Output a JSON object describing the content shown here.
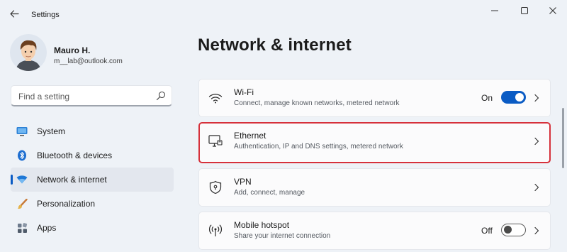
{
  "window": {
    "title": "Settings",
    "controls": [
      "minimize",
      "maximize",
      "close"
    ]
  },
  "profile": {
    "name": "Mauro H.",
    "email": "m__lab@outlook.com"
  },
  "search": {
    "placeholder": "Find a setting",
    "value": ""
  },
  "sidebar": {
    "items": [
      {
        "label": "System",
        "icon": "monitor-icon",
        "active": false
      },
      {
        "label": "Bluetooth & devices",
        "icon": "bluetooth-icon",
        "active": false
      },
      {
        "label": "Network & internet",
        "icon": "network-wifi-icon",
        "active": true
      },
      {
        "label": "Personalization",
        "icon": "brush-icon",
        "active": false
      },
      {
        "label": "Apps",
        "icon": "apps-icon",
        "active": false
      }
    ]
  },
  "main": {
    "title": "Network & internet",
    "cards": [
      {
        "title": "Wi-Fi",
        "subtitle": "Connect, manage known networks, metered network",
        "icon": "wifi-icon",
        "toggle": {
          "state_label": "On",
          "on": true
        }
      },
      {
        "title": "Ethernet",
        "subtitle": "Authentication, IP and DNS settings, metered network",
        "icon": "ethernet-icon",
        "highlighted": true
      },
      {
        "title": "VPN",
        "subtitle": "Add, connect, manage",
        "icon": "vpn-shield-icon"
      },
      {
        "title": "Mobile hotspot",
        "subtitle": "Share your internet connection",
        "icon": "hotspot-icon",
        "toggle": {
          "state_label": "Off",
          "on": false
        }
      }
    ]
  },
  "colors": {
    "accent": "#0a5bc4",
    "highlight_border": "#d6313b",
    "background": "#eef2f7",
    "card": "#fbfbfc"
  }
}
